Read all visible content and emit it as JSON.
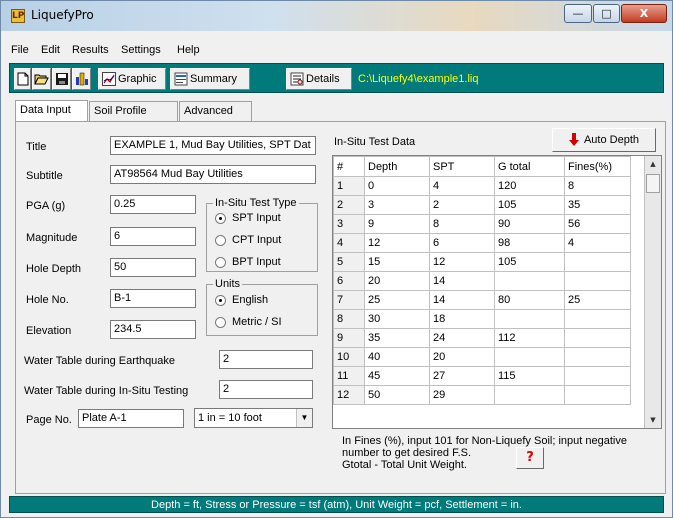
{
  "window": {
    "title": "LiquefyPro",
    "app_icon_glyph": "LP",
    "min_glyph": "—",
    "max_glyph": "□",
    "close_glyph": "X"
  },
  "menu": [
    "File",
    "Edit",
    "Results",
    "Settings",
    "Help"
  ],
  "toolbar": {
    "graphic": "Graphic",
    "summary": "Summary",
    "details": "Details",
    "file_path": "C:\\Liquefy4\\example1.liq"
  },
  "tabs": [
    "Data Input",
    "Soil Profile",
    "Advanced"
  ],
  "form": {
    "title_label": "Title",
    "title_value": "EXAMPLE 1, Mud Bay Utilities, SPT Dat",
    "subtitle_label": "Subtitle",
    "subtitle_value": "AT98564  Mud Bay Utilities",
    "pga_label": "PGA (g)",
    "pga_value": "0.25",
    "magnitude_label": "Magnitude",
    "magnitude_value": "6",
    "hole_depth_label": "Hole Depth",
    "hole_depth_value": "50",
    "hole_no_label": "Hole No.",
    "hole_no_value": "B-1",
    "elevation_label": "Elevation",
    "elevation_value": "234.5",
    "wt_eq_label": "Water Table during Earthquake",
    "wt_eq_value": "2",
    "wt_insitu_label": "Water Table during In-Situ Testing",
    "wt_insitu_value": "2",
    "page_no_label": "Page No.",
    "page_no_value": "Plate A-1",
    "scale_value": "1 in = 10 foot"
  },
  "test_type": {
    "title": "In-Situ Test Type",
    "options": [
      "SPT Input",
      "CPT Input",
      "BPT Input"
    ],
    "selected": 0
  },
  "units": {
    "title": "Units",
    "options": [
      "English",
      "Metric / SI"
    ],
    "selected": 0
  },
  "insitu": {
    "heading": "In-Situ Test Data",
    "auto_depth": "Auto Depth",
    "columns": [
      "#",
      "Depth",
      "SPT",
      "G total",
      "Fines(%)"
    ],
    "rows": [
      [
        "1",
        "0",
        "4",
        "120",
        "8"
      ],
      [
        "2",
        "3",
        "2",
        "105",
        "35"
      ],
      [
        "3",
        "9",
        "8",
        "90",
        "56"
      ],
      [
        "4",
        "12",
        "6",
        "98",
        "4"
      ],
      [
        "5",
        "15",
        "12",
        "105",
        ""
      ],
      [
        "6",
        "20",
        "14",
        "",
        ""
      ],
      [
        "7",
        "25",
        "14",
        "80",
        "25"
      ],
      [
        "8",
        "30",
        "18",
        "",
        ""
      ],
      [
        "9",
        "35",
        "24",
        "112",
        ""
      ],
      [
        "10",
        "40",
        "20",
        "",
        ""
      ],
      [
        "11",
        "45",
        "27",
        "115",
        ""
      ],
      [
        "12",
        "50",
        "29",
        "",
        ""
      ]
    ],
    "note_line1": "In Fines (%), input 101 for Non-Liquefy Soil; input negative",
    "note_line2": "number to get desired  F.S.",
    "note_line3": "Gtotal - Total Unit Weight.",
    "help": "?"
  },
  "status": "Depth = ft, Stress or Pressure = tsf (atm), Unit Weight = pcf, Settlement = in."
}
